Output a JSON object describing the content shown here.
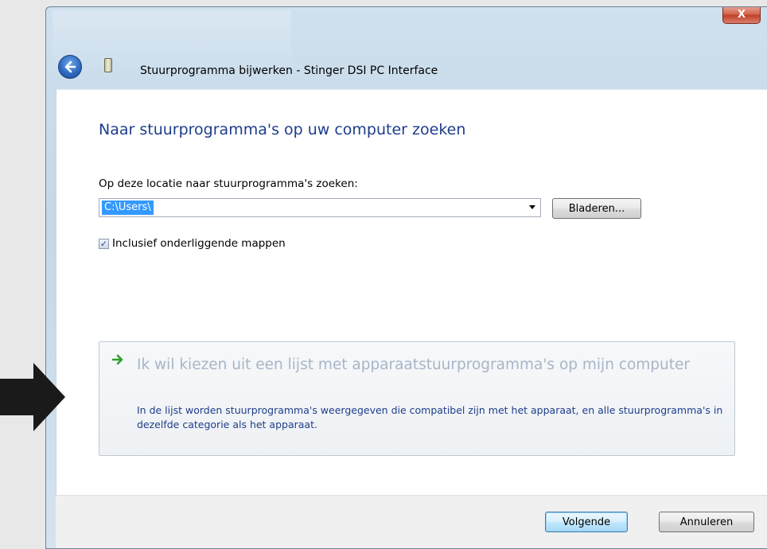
{
  "window": {
    "title": "Stuurprogramma bijwerken - Stinger DSI PC Interface",
    "close_label": "X"
  },
  "content": {
    "heading": "Naar stuurprogramma's op uw computer zoeken",
    "location_label": "Op deze locatie naar stuurprogramma's zoeken:",
    "location_value": "C:\\Users\\",
    "browse_button": "Bladeren...",
    "include_subfolders_label": "Inclusief onderliggende mappen",
    "include_subfolders_checked": true
  },
  "pick_option": {
    "title": "Ik wil kiezen uit een lijst met apparaatstuurprogramma's op mijn computer",
    "description": "In de lijst worden stuurprogramma's weergegeven die compatibel zijn met het apparaat, en alle stuurprogramma's in dezelfde categorie als het apparaat."
  },
  "footer": {
    "next_button": "Volgende",
    "cancel_button": "Annuleren"
  },
  "colors": {
    "heading": "#1e3d8a",
    "selection": "#3399ff",
    "pick_title": "#a9b5c6",
    "arrow_green": "#2ea02e"
  },
  "icons": {
    "back": "back-arrow-icon",
    "device": "device-icon",
    "pick_arrow": "green-arrow-icon",
    "pointer": "pointer-arrow-icon"
  }
}
